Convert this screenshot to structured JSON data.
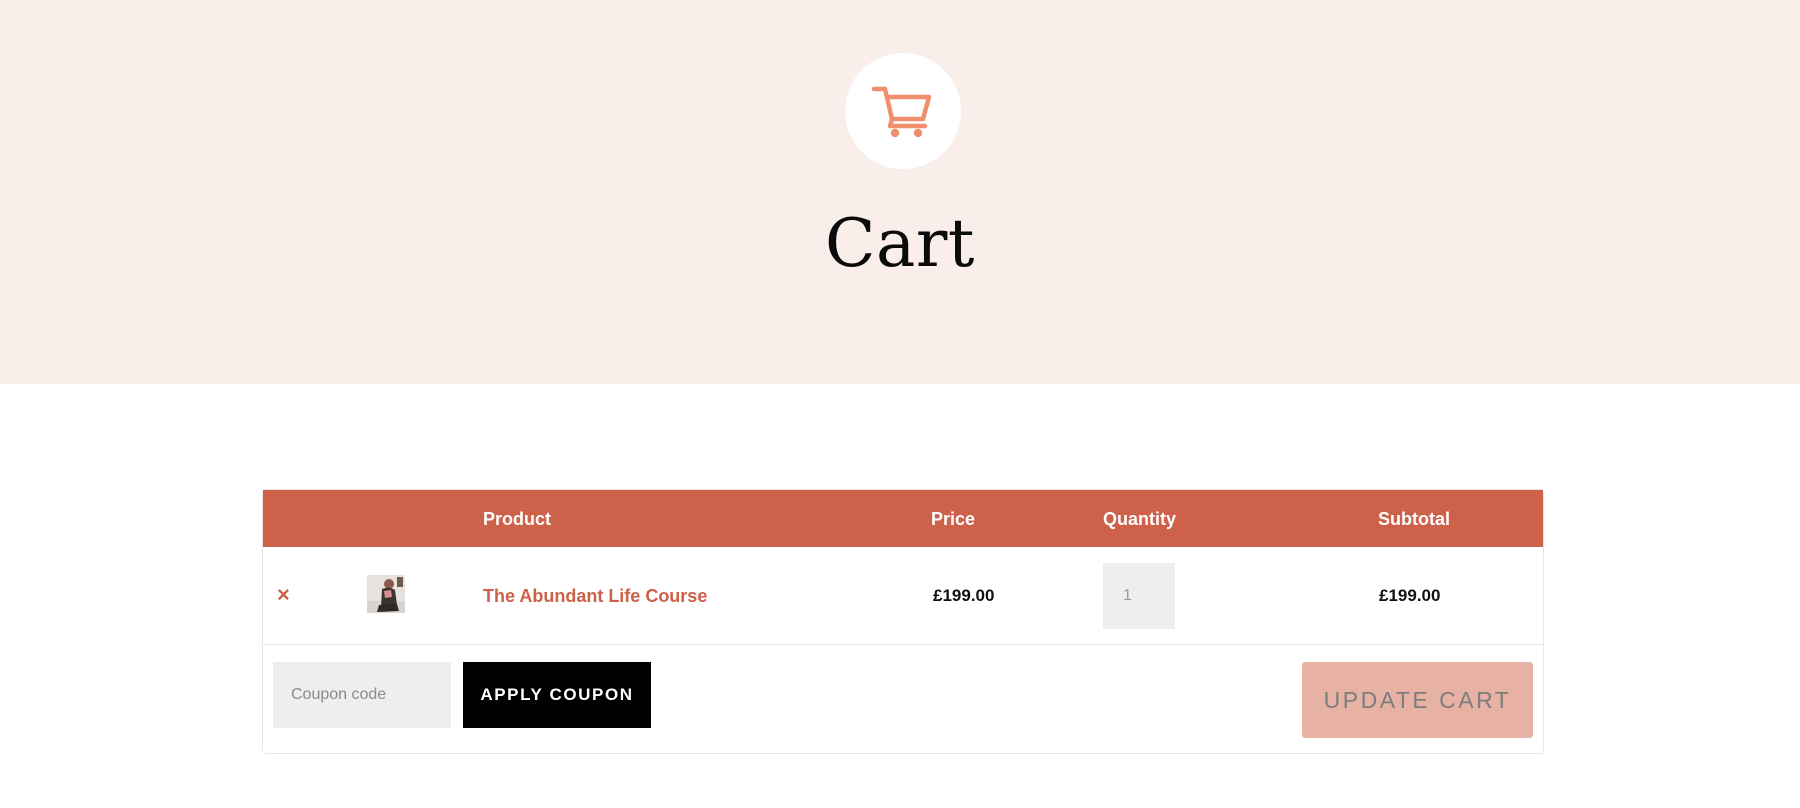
{
  "hero": {
    "title": "Cart",
    "icon": "cart-icon",
    "icon_color": "#ef8f6e",
    "background": "#f9eee9"
  },
  "table": {
    "header_color": "#cd6149",
    "columns": {
      "remove": "",
      "thumbnail": "",
      "product": "Product",
      "price": "Price",
      "quantity": "Quantity",
      "subtotal": "Subtotal"
    },
    "rows": [
      {
        "remove_symbol": "×",
        "product_name": "The Abundant Life Course",
        "price": "£199.00",
        "quantity": "1",
        "subtotal": "£199.00"
      }
    ]
  },
  "actions": {
    "coupon_placeholder": "Coupon code",
    "apply_label": "APPLY COUPON",
    "update_label": "UPDATE CART"
  }
}
